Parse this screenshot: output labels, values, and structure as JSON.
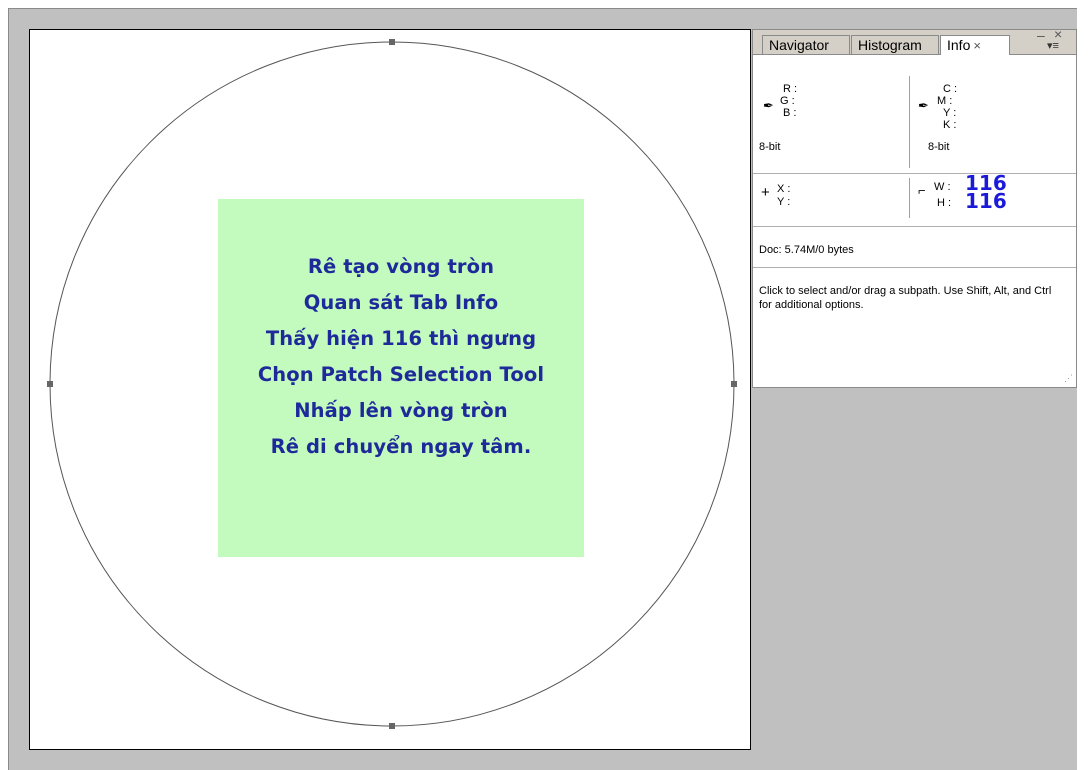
{
  "canvas": {
    "note_lines": [
      "Rê tạo vòng tròn",
      "Quan sát Tab Info",
      "Thấy hiện 116 thì ngưng",
      "Chọn Patch Selection Tool",
      "Nhấp lên vòng tròn",
      "Rê di chuyển ngay tâm."
    ],
    "colors": {
      "note_bg": "#c3fbbe",
      "note_text": "#1e2a9a"
    }
  },
  "panel": {
    "tabs": [
      {
        "label": "Navigator",
        "active": false
      },
      {
        "label": "Histogram",
        "active": false
      },
      {
        "label": "Info",
        "active": true
      }
    ],
    "tab_close": "×",
    "minimize": "–",
    "close": "×",
    "menu": "▾≡",
    "rgb": {
      "r": "R :",
      "g": "G :",
      "b": "B :",
      "bit": "8-bit"
    },
    "cmyk": {
      "c": "C :",
      "m": "M :",
      "y": "Y :",
      "k": "K :",
      "bit": "8-bit"
    },
    "xy": {
      "x": "X :",
      "y": "Y :"
    },
    "wh": {
      "w": "W :",
      "h": "H :",
      "w_value": "116",
      "h_value": "116"
    },
    "doc": "Doc: 5.74M/0 bytes",
    "hint": "Click to select and/or drag a subpath. Use Shift, Alt, and Ctrl for additional options.",
    "icons": {
      "eyedropper": "eyedropper-icon",
      "crosshair": "crosshair-icon",
      "selection": "selection-size-icon"
    },
    "value_color": "#1a1ad8"
  }
}
